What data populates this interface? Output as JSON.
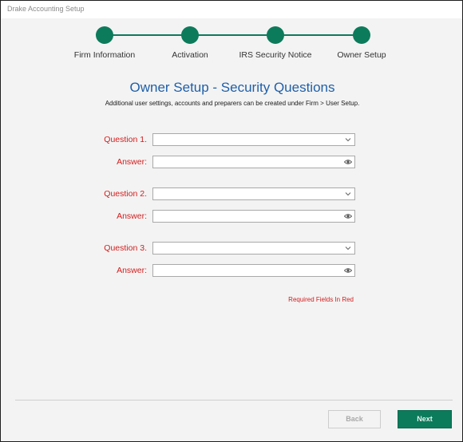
{
  "window": {
    "title": "Drake Accounting Setup"
  },
  "stepper": {
    "steps": [
      {
        "label": "Firm Information",
        "completed": true
      },
      {
        "label": "Activation",
        "completed": true
      },
      {
        "label": "IRS Security Notice",
        "completed": true
      },
      {
        "label": "Owner Setup",
        "completed": true
      }
    ],
    "accent_color": "#0c7b5b"
  },
  "main": {
    "title": "Owner Setup - Security Questions",
    "subtitle": "Additional user settings, accounts and preparers can be created under Firm > User Setup.",
    "questions": [
      {
        "question_label": "Question 1.",
        "question_value": "",
        "answer_label": "Answer:",
        "answer_value": ""
      },
      {
        "question_label": "Question 2.",
        "question_value": "",
        "answer_label": "Answer:",
        "answer_value": ""
      },
      {
        "question_label": "Question 3.",
        "question_value": "",
        "answer_label": "Answer:",
        "answer_value": ""
      }
    ],
    "required_note": "Required Fields In Red",
    "required_color": "#d41c1c"
  },
  "footer": {
    "back_label": "Back",
    "back_enabled": false,
    "next_label": "Next"
  },
  "icons": {
    "dropdown": "chevron-down-icon",
    "reveal": "eye-icon"
  }
}
